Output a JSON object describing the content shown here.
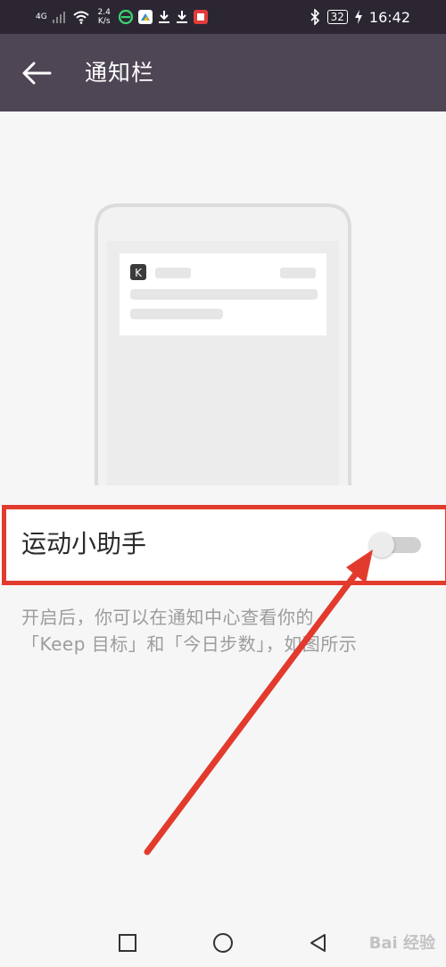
{
  "status_bar": {
    "network": "4G",
    "speed_value": "2.4",
    "speed_unit": "K/s",
    "battery": "32",
    "time": "16:42"
  },
  "app_bar": {
    "title": "通知栏"
  },
  "settings": {
    "assistant_label": "运动小助手",
    "assistant_enabled": false,
    "description_line1": "开启后，你可以在通知中心查看你的",
    "description_line2": "「Keep 目标」和「今日步数」，如图所示"
  },
  "preview": {
    "app_icon_letter": "K"
  },
  "watermark": {
    "text": "Bai 经验"
  },
  "colors": {
    "status_bar": "#2c2632",
    "app_bar": "#4e4654",
    "background": "#f6f6f7",
    "annotation": "#e23b2e"
  }
}
